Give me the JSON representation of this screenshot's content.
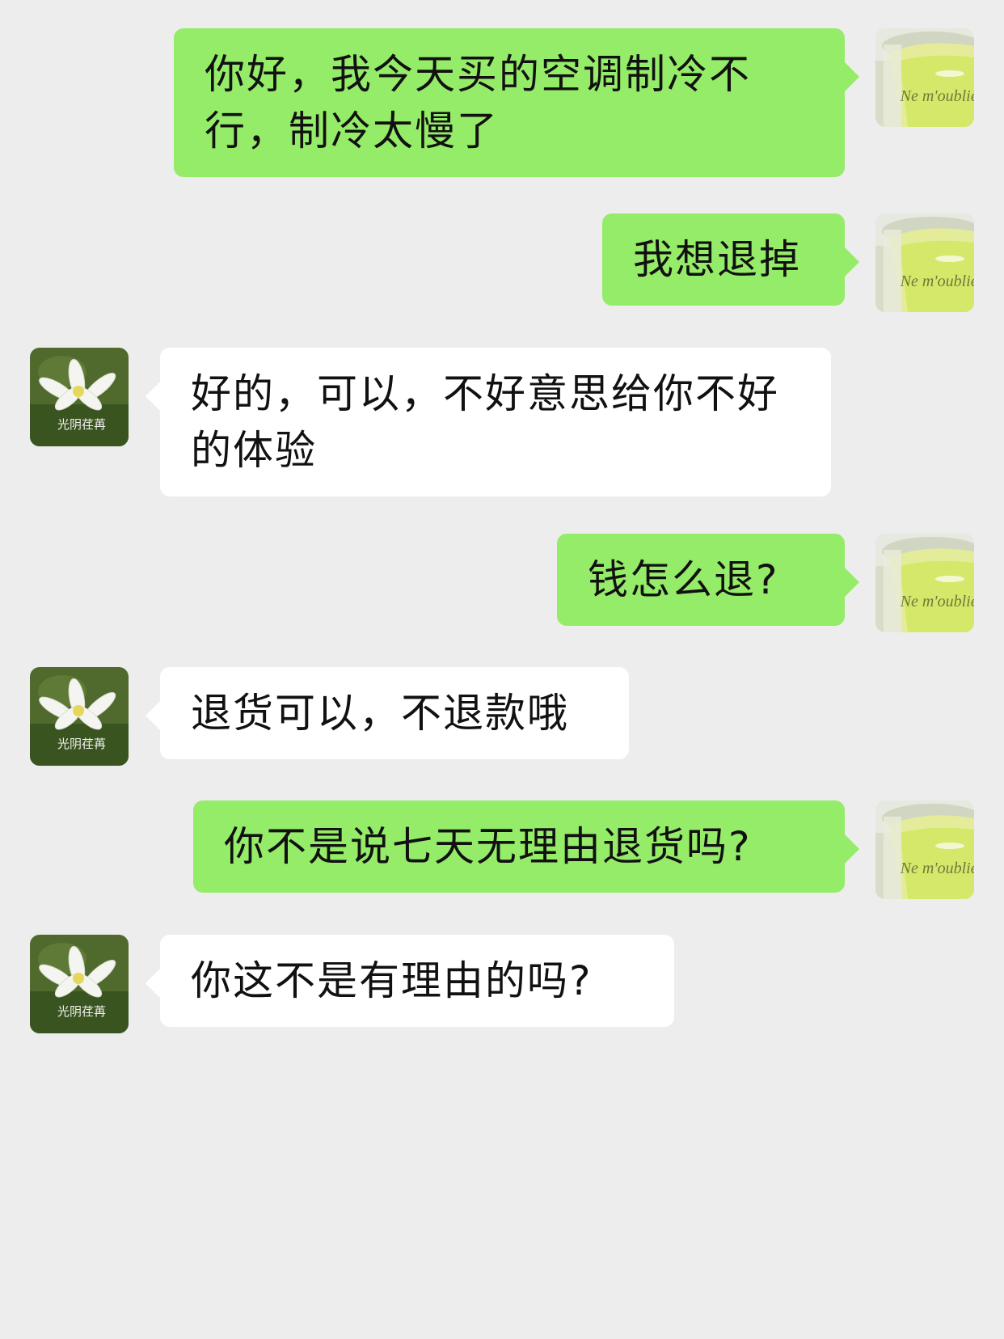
{
  "colors": {
    "background": "#ededed",
    "sent_bubble": "#95ec69",
    "received_bubble": "#ffffff",
    "text": "#111111"
  },
  "avatars": {
    "me": {
      "icon": "cup-photo-avatar",
      "label": "Ne m'oublie pas"
    },
    "them": {
      "icon": "white-lotus-avatar",
      "label": "光阴荏苒"
    }
  },
  "messages": [
    {
      "sender": "me",
      "text": "你好，我今天买的空调制冷不行，制冷太慢了"
    },
    {
      "sender": "me",
      "text": "我想退掉"
    },
    {
      "sender": "them",
      "text": "好的，可以，不好意思给你不好的体验"
    },
    {
      "sender": "me",
      "text": "钱怎么退?"
    },
    {
      "sender": "them",
      "text": "退货可以，不退款哦"
    },
    {
      "sender": "me",
      "text": "你不是说七天无理由退货吗?"
    },
    {
      "sender": "them",
      "text": "你这不是有理由的吗?"
    }
  ]
}
